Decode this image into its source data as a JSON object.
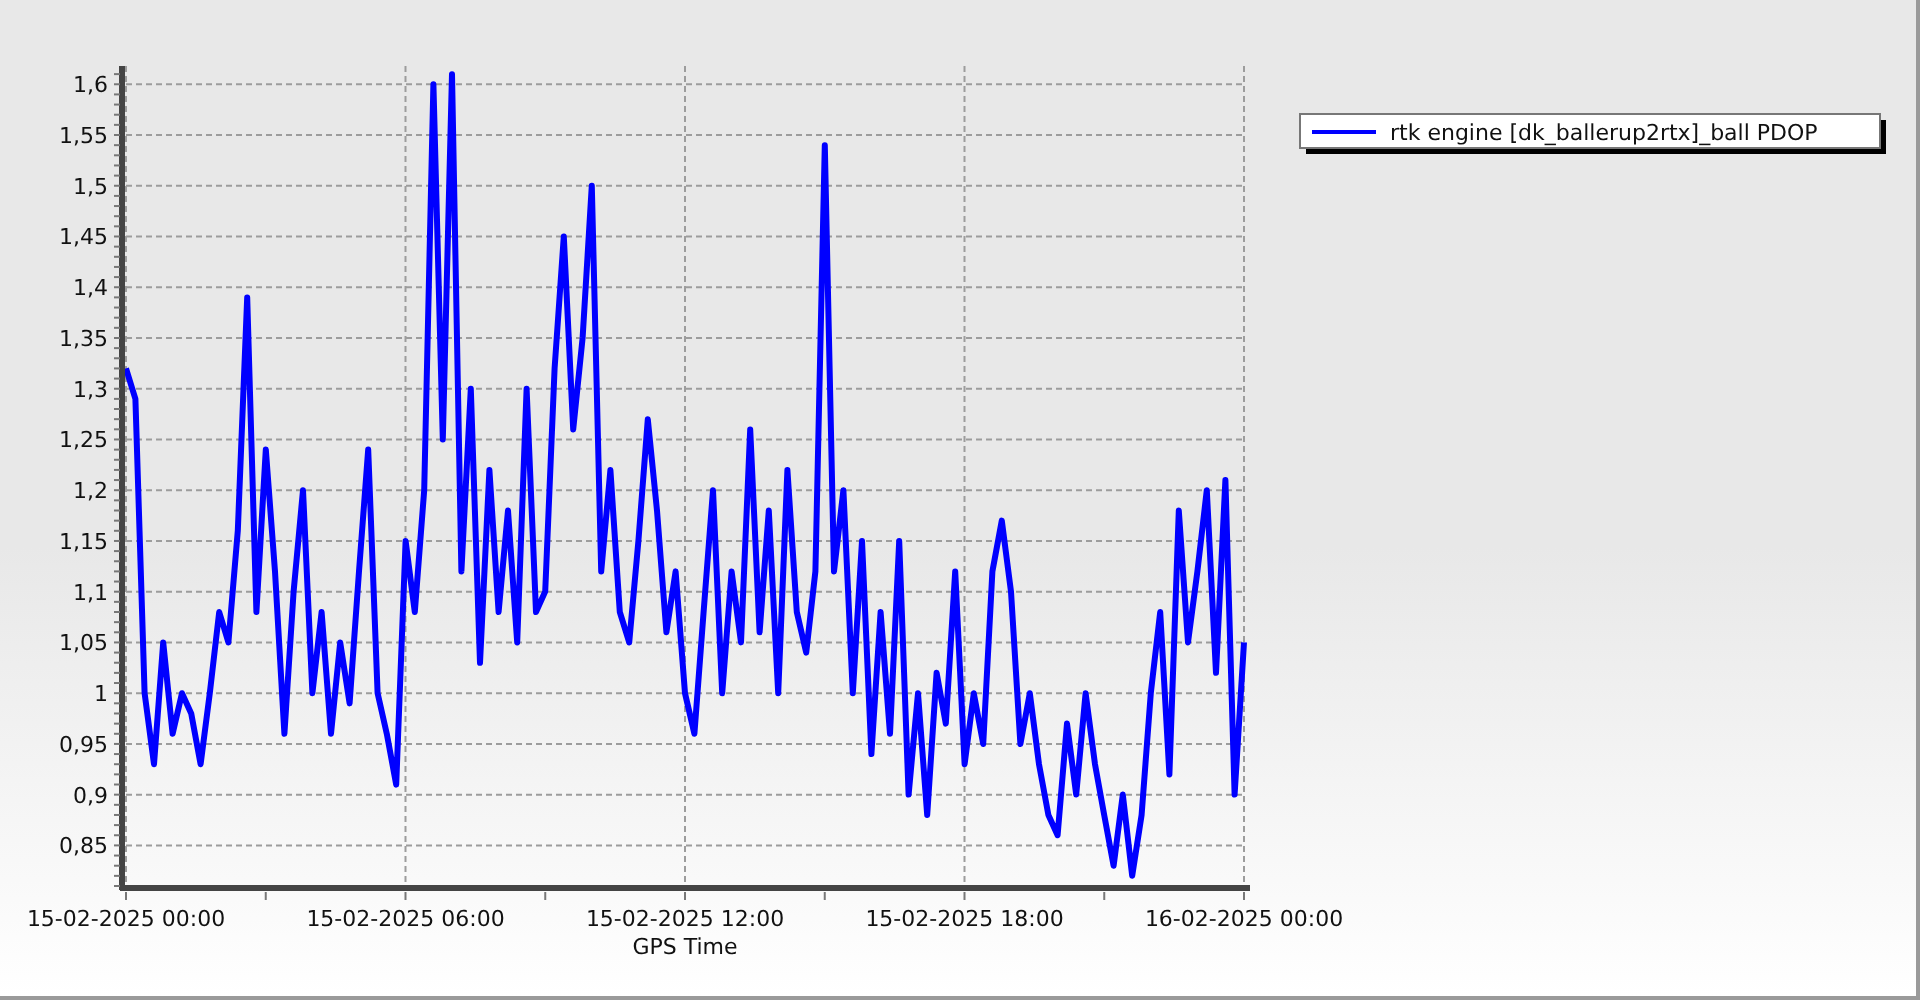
{
  "chart": {
    "chart_data": {
      "type": "line",
      "xlabel": "GPS Time",
      "grid": true,
      "ylim": [
        0.81,
        1.618
      ],
      "categories": [
        "15-02-2025 00:00",
        null,
        null,
        null,
        null,
        null,
        null,
        null,
        null,
        null,
        null,
        null,
        null,
        null,
        null,
        null,
        null,
        null,
        null,
        null,
        null,
        null,
        null,
        null,
        null,
        null,
        null,
        null,
        null,
        null,
        "15-02-2025 06:00",
        null,
        null,
        null,
        null,
        null,
        null,
        null,
        null,
        null,
        null,
        null,
        null,
        null,
        null,
        null,
        null,
        null,
        null,
        null,
        null,
        null,
        null,
        null,
        null,
        null,
        null,
        null,
        null,
        null,
        "15-02-2025 12:00",
        null,
        null,
        null,
        null,
        null,
        null,
        null,
        null,
        null,
        null,
        null,
        null,
        null,
        null,
        null,
        null,
        null,
        null,
        null,
        null,
        null,
        null,
        null,
        null,
        null,
        null,
        null,
        null,
        null,
        "15-02-2025 18:00",
        null,
        null,
        null,
        null,
        null,
        null,
        null,
        null,
        null,
        null,
        null,
        null,
        null,
        null,
        null,
        null,
        null,
        null,
        null,
        null,
        null,
        null,
        null,
        null,
        null,
        null,
        null,
        null,
        null,
        "16-02-2025 00:00"
      ],
      "yticks": [
        {
          "value": 0.85,
          "label": "0,85"
        },
        {
          "value": 0.9,
          "label": "0,9"
        },
        {
          "value": 0.95,
          "label": "0,95"
        },
        {
          "value": 1,
          "label": "1"
        },
        {
          "value": 1.05,
          "label": "1,05"
        },
        {
          "value": 1.1,
          "label": "1,1"
        },
        {
          "value": 1.15,
          "label": "1,15"
        },
        {
          "value": 1.2,
          "label": "1,2"
        },
        {
          "value": 1.25,
          "label": "1,25"
        },
        {
          "value": 1.3,
          "label": "1,3"
        },
        {
          "value": 1.35,
          "label": "1,35"
        },
        {
          "value": 1.4,
          "label": "1,4"
        },
        {
          "value": 1.45,
          "label": "1,45"
        },
        {
          "value": 1.5,
          "label": "1,5"
        },
        {
          "value": 1.55,
          "label": "1,55"
        },
        {
          "value": 1.6,
          "label": "1,6"
        }
      ],
      "series": [
        {
          "name": "rtk engine [dk_ballerup2rtx]_ball PDOP",
          "color": "#0000ff",
          "values": [
            1.32,
            1.29,
            1.0,
            0.93,
            1.05,
            0.96,
            1.0,
            0.98,
            0.93,
            1.0,
            1.08,
            1.05,
            1.16,
            1.39,
            1.08,
            1.24,
            1.12,
            0.96,
            1.1,
            1.2,
            1.0,
            1.08,
            0.96,
            1.05,
            0.99,
            1.12,
            1.24,
            1.0,
            0.96,
            0.91,
            1.15,
            1.08,
            1.2,
            1.6,
            1.25,
            1.61,
            1.12,
            1.3,
            1.03,
            1.22,
            1.08,
            1.18,
            1.05,
            1.3,
            1.08,
            1.1,
            1.32,
            1.45,
            1.26,
            1.35,
            1.5,
            1.12,
            1.22,
            1.08,
            1.05,
            1.15,
            1.27,
            1.18,
            1.06,
            1.12,
            1.0,
            0.96,
            1.08,
            1.2,
            1.0,
            1.12,
            1.05,
            1.26,
            1.06,
            1.18,
            1.0,
            1.22,
            1.08,
            1.04,
            1.12,
            1.54,
            1.12,
            1.2,
            1.0,
            1.15,
            0.94,
            1.08,
            0.96,
            1.15,
            0.9,
            1.0,
            0.88,
            1.02,
            0.97,
            1.12,
            0.93,
            1.0,
            0.95,
            1.12,
            1.17,
            1.1,
            0.95,
            1.0,
            0.93,
            0.88,
            0.86,
            0.97,
            0.9,
            1.0,
            0.93,
            0.88,
            0.83,
            0.9,
            0.82,
            0.88,
            1.0,
            1.08,
            0.92,
            1.18,
            1.05,
            1.12,
            1.2,
            1.02,
            1.21,
            0.9,
            1.05
          ]
        }
      ]
    }
  }
}
